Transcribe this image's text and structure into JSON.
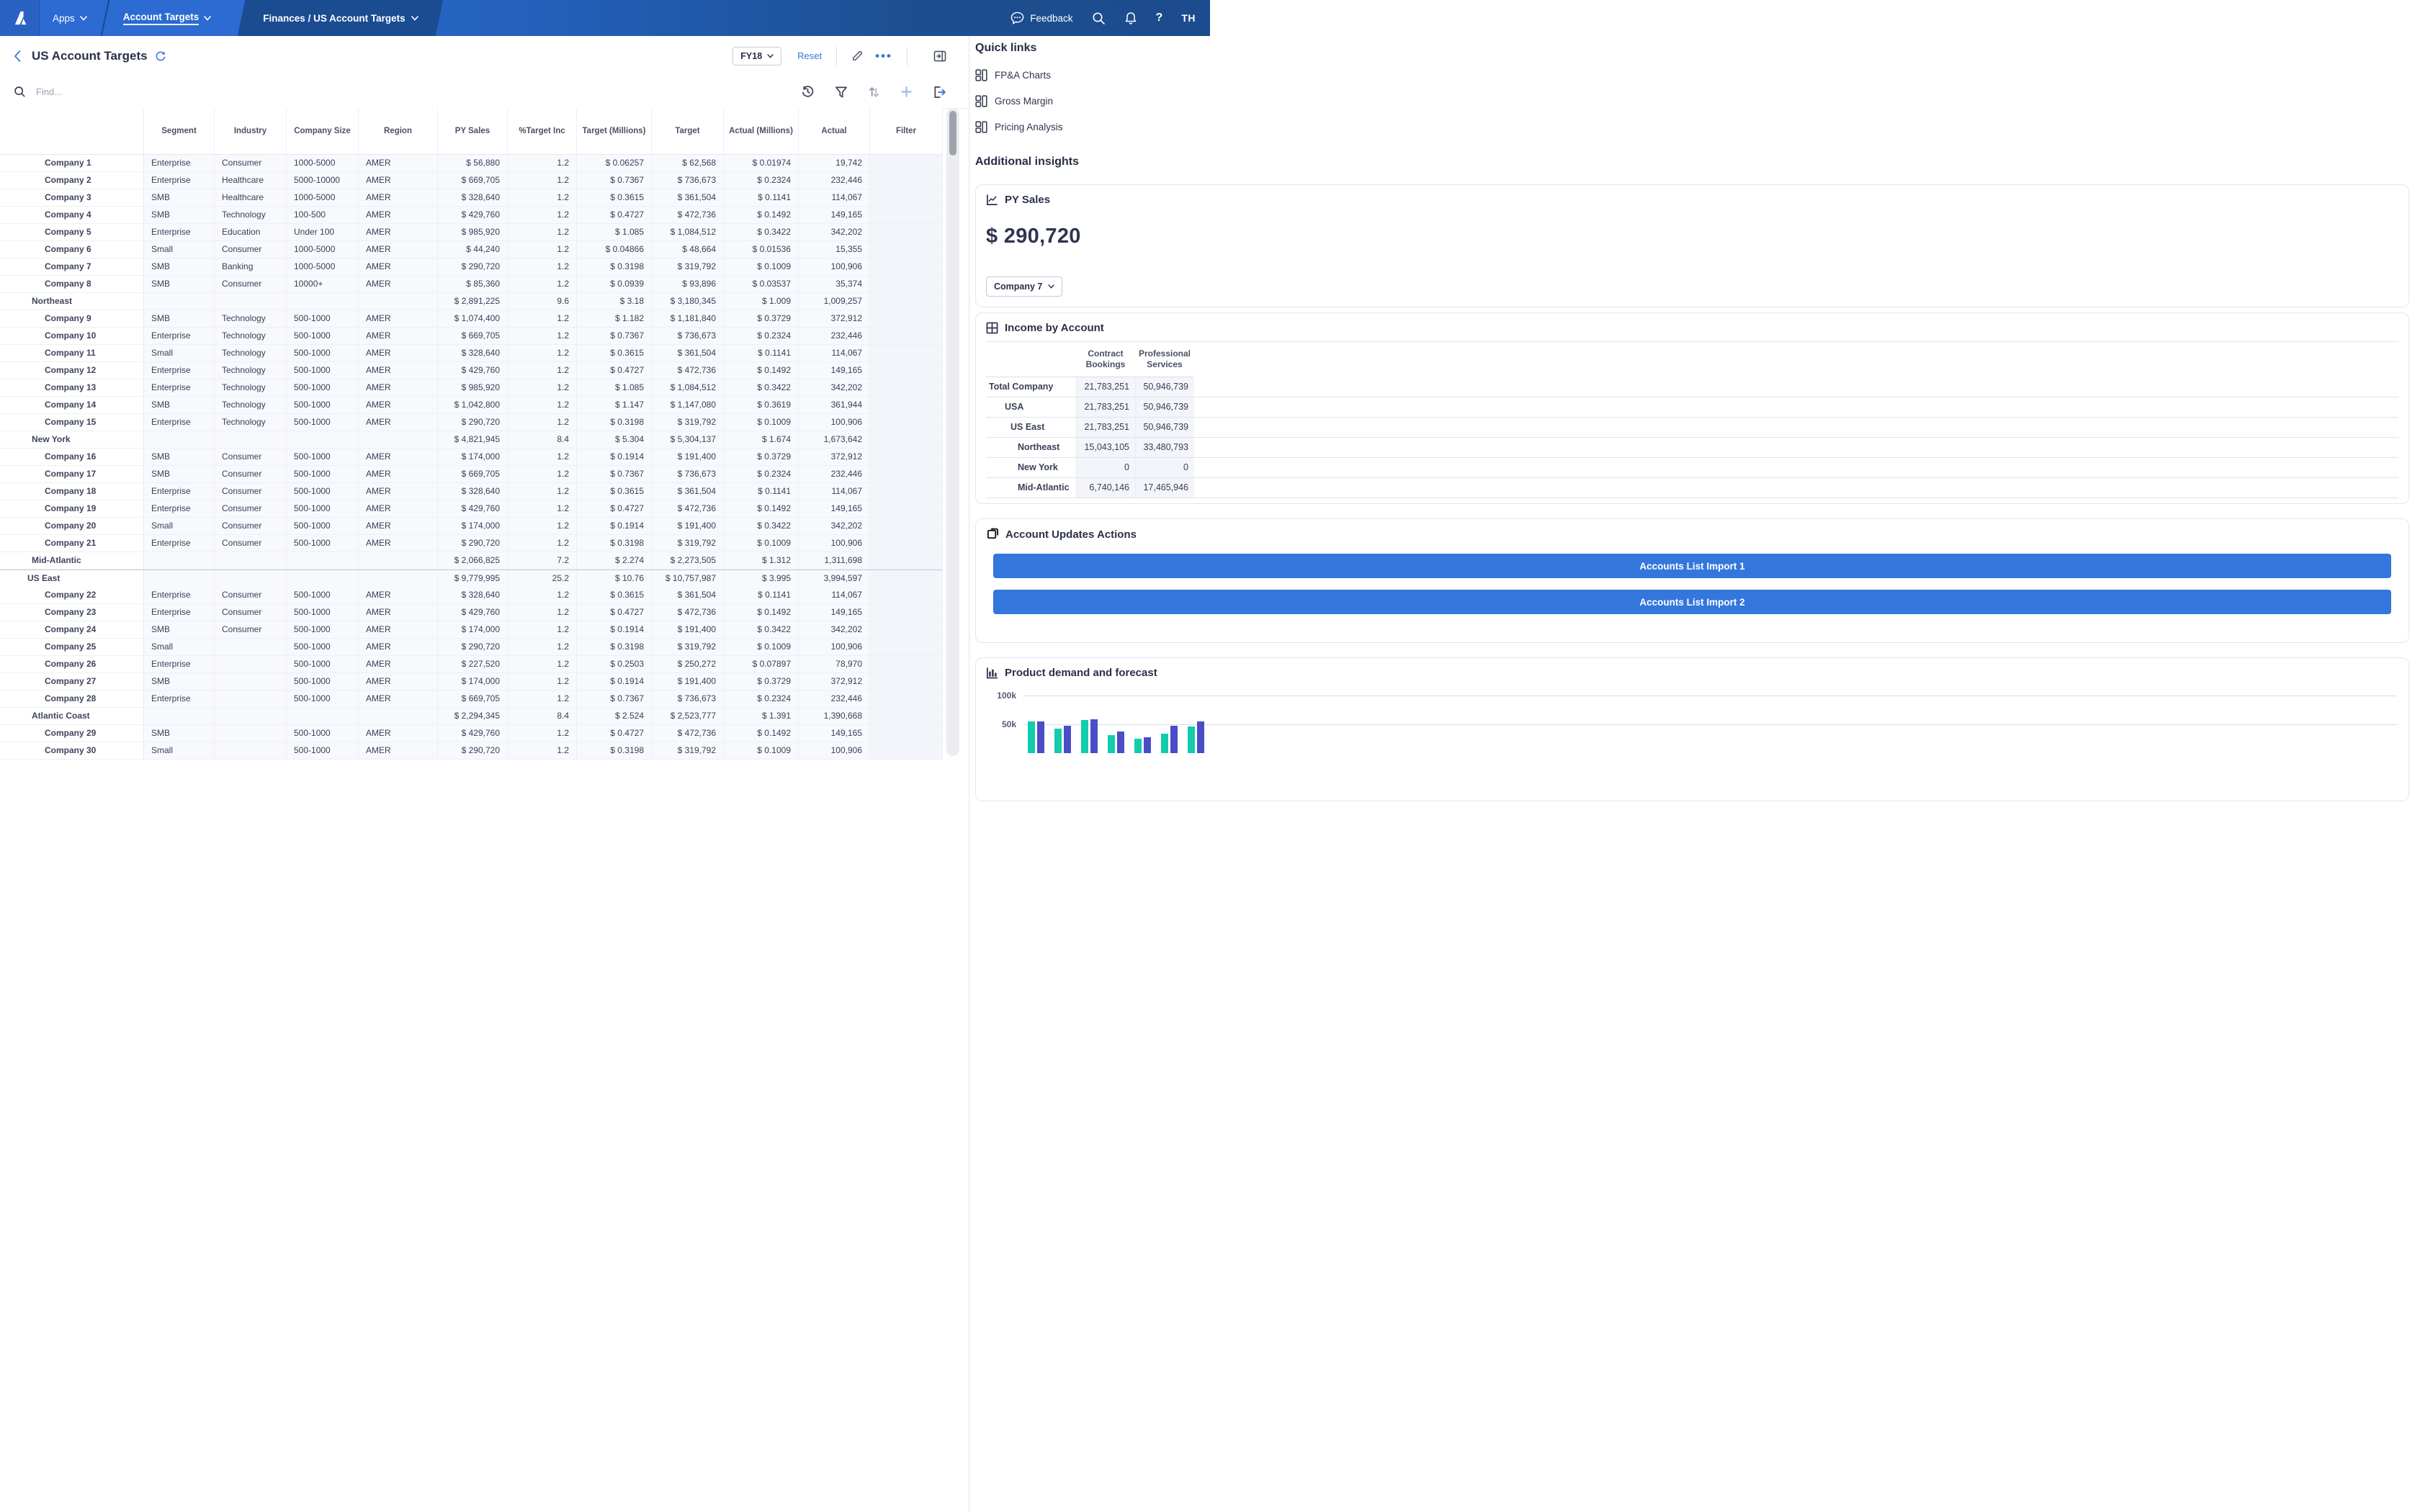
{
  "topbar": {
    "apps": "Apps",
    "account_targets": "Account Targets",
    "doc_tab": "Finances / US Account Targets",
    "feedback": "Feedback",
    "help": "?",
    "user_initials": "TH"
  },
  "title_row": {
    "title": "US Account Targets",
    "period": "FY18",
    "reset": "Reset"
  },
  "find": {
    "placeholder": "Find..."
  },
  "table": {
    "columns": [
      "",
      "Segment",
      "Industry",
      "Company Size",
      "Region",
      "PY Sales",
      "%Target Inc",
      "Target (Millions)",
      "Target",
      "Actual (Millions)",
      "Actual",
      "Filter"
    ],
    "rows": [
      {
        "cls": "trow lvl2",
        "cells": [
          "Company 1",
          "Enterprise",
          "Consumer",
          "1000-5000",
          "AMER",
          "$ 56,880",
          "1.2",
          "$ 0.06257",
          "$ 62,568",
          "$ 0.01974",
          "19,742",
          ""
        ]
      },
      {
        "cls": "trow lvl2",
        "cells": [
          "Company 2",
          "Enterprise",
          "Healthcare",
          "5000-10000",
          "AMER",
          "$ 669,705",
          "1.2",
          "$ 0.7367",
          "$ 736,673",
          "$ 0.2324",
          "232,446",
          ""
        ]
      },
      {
        "cls": "trow lvl2",
        "cells": [
          "Company 3",
          "SMB",
          "Healthcare",
          "1000-5000",
          "AMER",
          "$ 328,640",
          "1.2",
          "$ 0.3615",
          "$ 361,504",
          "$ 0.1141",
          "114,067",
          ""
        ]
      },
      {
        "cls": "trow lvl2",
        "cells": [
          "Company 4",
          "SMB",
          "Technology",
          "100-500",
          "AMER",
          "$ 429,760",
          "1.2",
          "$ 0.4727",
          "$ 472,736",
          "$ 0.1492",
          "149,165",
          ""
        ]
      },
      {
        "cls": "trow lvl2",
        "cells": [
          "Company 5",
          "Enterprise",
          "Education",
          "Under 100",
          "AMER",
          "$ 985,920",
          "1.2",
          "$ 1.085",
          "$ 1,084,512",
          "$ 0.3422",
          "342,202",
          ""
        ]
      },
      {
        "cls": "trow lvl2",
        "cells": [
          "Company 6",
          "Small",
          "Consumer",
          "1000-5000",
          "AMER",
          "$ 44,240",
          "1.2",
          "$ 0.04866",
          "$ 48,664",
          "$ 0.01536",
          "15,355",
          ""
        ]
      },
      {
        "cls": "trow lvl2",
        "cells": [
          "Company 7",
          "SMB",
          "Banking",
          "1000-5000",
          "AMER",
          "$ 290,720",
          "1.2",
          "$ 0.3198",
          "$ 319,792",
          "$ 0.1009",
          "100,906",
          ""
        ]
      },
      {
        "cls": "trow lvl2",
        "cells": [
          "Company 8",
          "SMB",
          "Consumer",
          "10000+",
          "AMER",
          "$ 85,360",
          "1.2",
          "$ 0.0939",
          "$ 93,896",
          "$ 0.03537",
          "35,374",
          ""
        ]
      },
      {
        "cls": "trow lvl1",
        "cells": [
          "Northeast",
          "",
          "",
          "",
          "",
          "$ 2,891,225",
          "9.6",
          "$ 3.18",
          "$ 3,180,345",
          "$ 1.009",
          "1,009,257",
          ""
        ]
      },
      {
        "cls": "trow lvl2",
        "cells": [
          "Company 9",
          "SMB",
          "Technology",
          "500-1000",
          "AMER",
          "$ 1,074,400",
          "1.2",
          "$ 1.182",
          "$ 1,181,840",
          "$ 0.3729",
          "372,912",
          ""
        ]
      },
      {
        "cls": "trow lvl2",
        "cells": [
          "Company 10",
          "Enterprise",
          "Technology",
          "500-1000",
          "AMER",
          "$ 669,705",
          "1.2",
          "$ 0.7367",
          "$ 736,673",
          "$ 0.2324",
          "232,446",
          ""
        ]
      },
      {
        "cls": "trow lvl2",
        "cells": [
          "Company 11",
          "Small",
          "Technology",
          "500-1000",
          "AMER",
          "$ 328,640",
          "1.2",
          "$ 0.3615",
          "$ 361,504",
          "$ 0.1141",
          "114,067",
          ""
        ]
      },
      {
        "cls": "trow lvl2",
        "cells": [
          "Company 12",
          "Enterprise",
          "Technology",
          "500-1000",
          "AMER",
          "$ 429,760",
          "1.2",
          "$ 0.4727",
          "$ 472,736",
          "$ 0.1492",
          "149,165",
          ""
        ]
      },
      {
        "cls": "trow lvl2",
        "cells": [
          "Company 13",
          "Enterprise",
          "Technology",
          "500-1000",
          "AMER",
          "$ 985,920",
          "1.2",
          "$ 1.085",
          "$ 1,084,512",
          "$ 0.3422",
          "342,202",
          ""
        ]
      },
      {
        "cls": "trow lvl2",
        "cells": [
          "Company 14",
          "SMB",
          "Technology",
          "500-1000",
          "AMER",
          "$ 1,042,800",
          "1.2",
          "$ 1.147",
          "$ 1,147,080",
          "$ 0.3619",
          "361,944",
          ""
        ]
      },
      {
        "cls": "trow lvl2",
        "cells": [
          "Company 15",
          "Enterprise",
          "Technology",
          "500-1000",
          "AMER",
          "$ 290,720",
          "1.2",
          "$ 0.3198",
          "$ 319,792",
          "$ 0.1009",
          "100,906",
          ""
        ]
      },
      {
        "cls": "trow lvl1",
        "cells": [
          "New York",
          "",
          "",
          "",
          "",
          "$ 4,821,945",
          "8.4",
          "$ 5.304",
          "$ 5,304,137",
          "$ 1.674",
          "1,673,642",
          ""
        ]
      },
      {
        "cls": "trow lvl2",
        "cells": [
          "Company 16",
          "SMB",
          "Consumer",
          "500-1000",
          "AMER",
          "$ 174,000",
          "1.2",
          "$ 0.1914",
          "$ 191,400",
          "$ 0.3729",
          "372,912",
          ""
        ]
      },
      {
        "cls": "trow lvl2",
        "cells": [
          "Company 17",
          "SMB",
          "Consumer",
          "500-1000",
          "AMER",
          "$ 669,705",
          "1.2",
          "$ 0.7367",
          "$ 736,673",
          "$ 0.2324",
          "232,446",
          ""
        ]
      },
      {
        "cls": "trow lvl2",
        "cells": [
          "Company 18",
          "Enterprise",
          "Consumer",
          "500-1000",
          "AMER",
          "$ 328,640",
          "1.2",
          "$ 0.3615",
          "$ 361,504",
          "$ 0.1141",
          "114,067",
          ""
        ]
      },
      {
        "cls": "trow lvl2",
        "cells": [
          "Company 19",
          "Enterprise",
          "Consumer",
          "500-1000",
          "AMER",
          "$ 429,760",
          "1.2",
          "$ 0.4727",
          "$ 472,736",
          "$ 0.1492",
          "149,165",
          ""
        ]
      },
      {
        "cls": "trow lvl2",
        "cells": [
          "Company 20",
          "Small",
          "Consumer",
          "500-1000",
          "AMER",
          "$ 174,000",
          "1.2",
          "$ 0.1914",
          "$ 191,400",
          "$ 0.3422",
          "342,202",
          ""
        ]
      },
      {
        "cls": "trow lvl2",
        "cells": [
          "Company 21",
          "Enterprise",
          "Consumer",
          "500-1000",
          "AMER",
          "$ 290,720",
          "1.2",
          "$ 0.3198",
          "$ 319,792",
          "$ 0.1009",
          "100,906",
          ""
        ]
      },
      {
        "cls": "trow lvl1",
        "cells": [
          "Mid-Atlantic",
          "",
          "",
          "",
          "",
          "$ 2,066,825",
          "7.2",
          "$ 2.274",
          "$ 2,273,505",
          "$ 1.312",
          "1,311,698",
          ""
        ]
      },
      {
        "cls": "trow lvl0",
        "cells": [
          "US East",
          "",
          "",
          "",
          "",
          "$ 9,779,995",
          "25.2",
          "$ 10.76",
          "$ 10,757,987",
          "$ 3.995",
          "3,994,597",
          ""
        ]
      },
      {
        "cls": "trow lvl2",
        "cells": [
          "Company 22",
          "Enterprise",
          "Consumer",
          "500-1000",
          "AMER",
          "$ 328,640",
          "1.2",
          "$ 0.3615",
          "$ 361,504",
          "$ 0.1141",
          "114,067",
          ""
        ]
      },
      {
        "cls": "trow lvl2",
        "cells": [
          "Company 23",
          "Enterprise",
          "Consumer",
          "500-1000",
          "AMER",
          "$ 429,760",
          "1.2",
          "$ 0.4727",
          "$ 472,736",
          "$ 0.1492",
          "149,165",
          ""
        ]
      },
      {
        "cls": "trow lvl2",
        "cells": [
          "Company 24",
          "SMB",
          "Consumer",
          "500-1000",
          "AMER",
          "$ 174,000",
          "1.2",
          "$ 0.1914",
          "$ 191,400",
          "$ 0.3422",
          "342,202",
          ""
        ]
      },
      {
        "cls": "trow lvl2",
        "cells": [
          "Company 25",
          "Small",
          "",
          "500-1000",
          "AMER",
          "$ 290,720",
          "1.2",
          "$ 0.3198",
          "$ 319,792",
          "$ 0.1009",
          "100,906",
          ""
        ]
      },
      {
        "cls": "trow lvl2",
        "cells": [
          "Company 26",
          "Enterprise",
          "",
          "500-1000",
          "AMER",
          "$ 227,520",
          "1.2",
          "$ 0.2503",
          "$ 250,272",
          "$ 0.07897",
          "78,970",
          ""
        ]
      },
      {
        "cls": "trow lvl2",
        "cells": [
          "Company 27",
          "SMB",
          "",
          "500-1000",
          "AMER",
          "$ 174,000",
          "1.2",
          "$ 0.1914",
          "$ 191,400",
          "$ 0.3729",
          "372,912",
          ""
        ]
      },
      {
        "cls": "trow lvl2",
        "cells": [
          "Company 28",
          "Enterprise",
          "",
          "500-1000",
          "AMER",
          "$ 669,705",
          "1.2",
          "$ 0.7367",
          "$ 736,673",
          "$ 0.2324",
          "232,446",
          ""
        ]
      },
      {
        "cls": "trow lvl1",
        "cells": [
          "Atlantic Coast",
          "",
          "",
          "",
          "",
          "$ 2,294,345",
          "8.4",
          "$ 2.524",
          "$ 2,523,777",
          "$ 1.391",
          "1,390,668",
          ""
        ]
      },
      {
        "cls": "trow lvl2",
        "cells": [
          "Company 29",
          "SMB",
          "",
          "500-1000",
          "AMER",
          "$ 429,760",
          "1.2",
          "$ 0.4727",
          "$ 472,736",
          "$ 0.1492",
          "149,165",
          ""
        ]
      },
      {
        "cls": "trow lvl2",
        "cells": [
          "Company 30",
          "Small",
          "",
          "500-1000",
          "AMER",
          "$ 290,720",
          "1.2",
          "$ 0.3198",
          "$ 319,792",
          "$ 0.1009",
          "100,906",
          ""
        ]
      }
    ]
  },
  "sidebar": {
    "quick_links_title": "Quick links",
    "links": [
      {
        "label": "FP&A Charts"
      },
      {
        "label": "Gross Margin"
      },
      {
        "label": "Pricing Analysis"
      }
    ],
    "insights_title": "Additional insights",
    "py_sales": {
      "title": "PY Sales",
      "value": "$ 290,720",
      "selector": "Company 7"
    },
    "income": {
      "title": "Income by Account",
      "col1": "Contract Bookings",
      "col2": "Professional Services",
      "rows": [
        {
          "label": "Total Company",
          "lcls": "ilabel il0",
          "cb": "21,783,251",
          "ps": "50,946,739"
        },
        {
          "label": "USA",
          "lcls": "ilabel il1",
          "cb": "21,783,251",
          "ps": "50,946,739"
        },
        {
          "label": "US East",
          "lcls": "ilabel il2",
          "cb": "21,783,251",
          "ps": "50,946,739"
        },
        {
          "label": "Northeast",
          "lcls": "ilabel il3",
          "cb": "15,043,105",
          "ps": "33,480,793"
        },
        {
          "label": "New York",
          "lcls": "ilabel il3",
          "cb": "0",
          "ps": "0"
        },
        {
          "label": "Mid-Atlantic",
          "lcls": "ilabel il3",
          "cb": "6,740,146",
          "ps": "17,465,946"
        }
      ]
    },
    "actions": {
      "title": "Account Updates Actions",
      "buttons": [
        {
          "label": "Accounts List Import 1"
        },
        {
          "label": "Accounts List Import 2"
        }
      ]
    }
  },
  "chart_data": {
    "type": "bar",
    "title": "Product demand and forecast",
    "ylabels": [
      "100k",
      "50k"
    ],
    "ylim": [
      0,
      100000
    ],
    "grid": true,
    "legend": "none",
    "categories": [
      "",
      "",
      "",
      "",
      "",
      "",
      ""
    ],
    "series": [
      {
        "name": "demand",
        "color": "#12CCAC",
        "values": [
          55000,
          43000,
          57000,
          31000,
          25000,
          34000,
          46000
        ]
      },
      {
        "name": "forecast",
        "color": "#4A4DC5",
        "values": [
          55000,
          48000,
          59000,
          37000,
          28000,
          48000,
          55000
        ]
      }
    ]
  }
}
